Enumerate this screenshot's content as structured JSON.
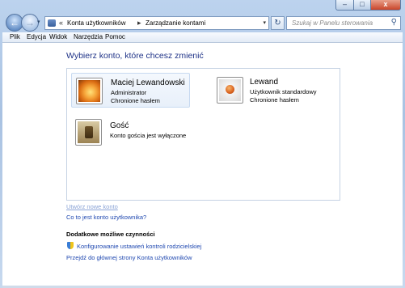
{
  "window": {
    "controls": {
      "minimize": "–",
      "maximize": "□",
      "close": "x"
    }
  },
  "nav": {
    "back_icon": "arrow-left-icon",
    "forward_icon": "arrow-right-icon",
    "dropdown": "▾",
    "breadcrumb": {
      "overflow": "«",
      "items": [
        "Konta użytkowników",
        "Zarządzanie kontami"
      ],
      "separator": "▸",
      "dropdown": "▾"
    },
    "refresh": "↻",
    "search_placeholder": "Szukaj w Panelu sterowania",
    "search_icon": "⚲"
  },
  "menu": [
    "Plik",
    "Edycja",
    "Widok",
    "Narzędzia",
    "Pomoc"
  ],
  "main": {
    "heading": "Wybierz konto, które chcesz zmienić",
    "accounts": [
      {
        "name": "Maciej Lewandowski",
        "role": "Administrator",
        "status": "Chronione hasłem",
        "picture": "flower",
        "selected": true
      },
      {
        "name": "Lewand",
        "role": "Użytkownik standardowy",
        "status": "Chronione hasłem",
        "picture": "robot",
        "selected": false
      },
      {
        "name": "Gość",
        "role": "Konto gościa jest wyłączone",
        "status": "",
        "picture": "guest",
        "selected": false
      }
    ],
    "links": {
      "create_account": "Utwórz nowe konto",
      "what_is_account": "Co to jest konto użytkownika?"
    },
    "additional": {
      "title": "Dodatkowe możliwe czynności",
      "parental_controls": "Konfigurowanie ustawień kontroli rodzicielskiej",
      "main_page": "Przejdź do głównej strony Konta użytkowników"
    }
  }
}
